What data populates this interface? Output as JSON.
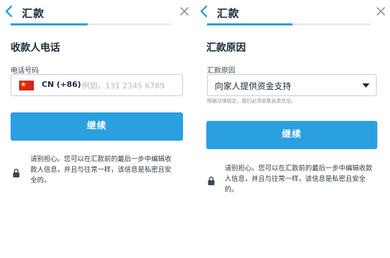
{
  "colors": {
    "accent": "#2aa0e0",
    "text": "#1c2a36"
  },
  "left": {
    "header": {
      "title": "汇款",
      "back_icon": "chevron-left-icon",
      "close_icon": "close-icon",
      "progress_percent": 48
    },
    "section_title": "收款人电话",
    "phone": {
      "label": "电话号码",
      "country_flag": "cn-flag-icon",
      "country_code": "CN (+86)",
      "placeholder": "例如，131 2345 6789"
    },
    "continue_label": "继续",
    "note": {
      "icon": "lock-icon",
      "text": "请别担心。您可以在汇款前的最后一步中编辑收款人信息，并且与往常一样，该信息是私密且安全的。"
    }
  },
  "right": {
    "header": {
      "title": "汇款",
      "back_icon": "chevron-left-icon",
      "close_icon": "close-icon",
      "progress_percent": 52
    },
    "section_title": "汇款原因",
    "reason": {
      "label": "汇款原因",
      "selected": "向家人提供资金支持",
      "hint": "根据法律规定，我们必须收集此类信息。"
    },
    "continue_label": "继续",
    "note": {
      "icon": "lock-icon",
      "text": "请别担心。您可以在汇款前的最后一步中编辑收款人信息，并且与往常一样，该信息是私密且安全的。"
    }
  }
}
